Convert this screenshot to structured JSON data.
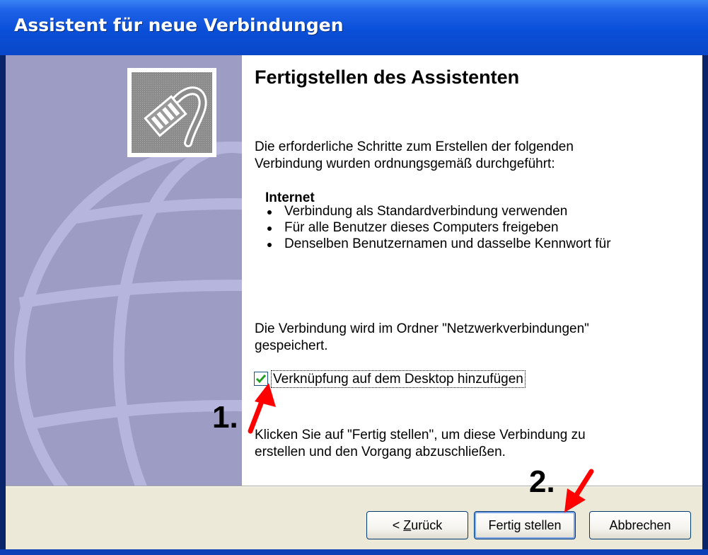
{
  "window": {
    "title": "Assistent für neue Verbindungen"
  },
  "content": {
    "heading": "Fertigstellen des Assistenten",
    "intro_line1": "Die erforderliche Schritte zum Erstellen der folgenden",
    "intro_line2": "Verbindung wurden ordnungsgemäß durchgeführt:",
    "connection_name": "Internet",
    "settings": [
      "Verbindung als Standardverbindung verwenden",
      "Für alle Benutzer dieses Computers freigeben",
      "Denselben Benutzernamen und dasselbe Kennwort für"
    ],
    "saved_line1": "Die Verbindung wird im Ordner \"Netzwerkverbindungen\"",
    "saved_line2": "gespeichert.",
    "shortcut_checkbox": {
      "label": "Verknüpfung auf dem Desktop hinzufügen",
      "checked": true
    },
    "finish_line1": "Klicken Sie auf \"Fertig stellen\", um diese Verbindung zu",
    "finish_line2": "erstellen und den Vorgang abzuschließen."
  },
  "buttons": {
    "back_prefix": "< ",
    "back_mnemonic": "Z",
    "back_rest": "urück",
    "finish": "Fertig stellen",
    "cancel": "Abbrechen"
  },
  "annotations": {
    "step1": "1.",
    "step2": "2.",
    "arrow_color": "#ff0000"
  },
  "colors": {
    "titlebar": "#0a4fd8",
    "side_panel": "#9d9cc4",
    "dialog_background": "#ece9d8",
    "checkmark": "#21a121"
  },
  "icons": {
    "side_logo": "network-cable-icon",
    "side_watermark": "globe-icon"
  }
}
